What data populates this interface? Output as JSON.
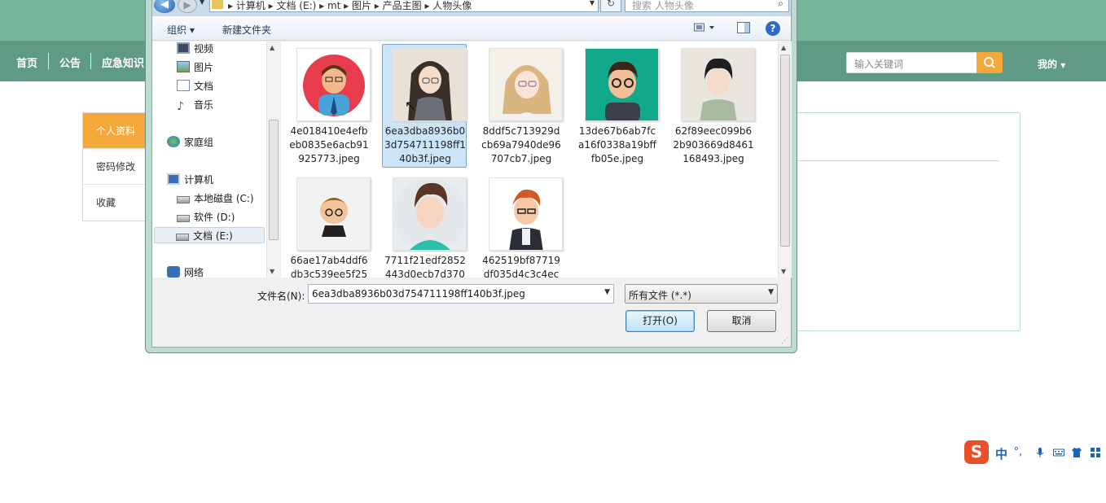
{
  "site": {
    "nav": [
      "首页",
      "公告",
      "应急知识"
    ],
    "search_placeholder": "输入关键词",
    "user_menu": "我的",
    "side_menu": [
      "个人资料",
      "密码修改",
      "收藏"
    ],
    "colors": {
      "topband": "#77b59b",
      "navbar": "#5e9a84",
      "accent": "#f5a83a"
    }
  },
  "dialog": {
    "address": "▸ 计算机 ▸ 文档 (E:) ▸ mt ▸ 图片 ▸ 产品主图 ▸ 人物头像",
    "search_placeholder": "搜索 人物头像",
    "toolbar": {
      "organize": "组织 ▾",
      "new_folder": "新建文件夹"
    },
    "nav_items": [
      {
        "label": "视频",
        "icon": "video-icon"
      },
      {
        "label": "图片",
        "icon": "pictures-icon"
      },
      {
        "label": "文档",
        "icon": "documents-icon"
      },
      {
        "label": "音乐",
        "icon": "music-icon"
      },
      {
        "label": "家庭组",
        "icon": "homegroup-icon"
      },
      {
        "label": "计算机",
        "icon": "computer-icon"
      },
      {
        "label": "本地磁盘 (C:)",
        "icon": "drive-icon"
      },
      {
        "label": "软件 (D:)",
        "icon": "drive-icon"
      },
      {
        "label": "文档 (E:)",
        "icon": "drive-icon"
      },
      {
        "label": "网络",
        "icon": "network-icon"
      }
    ],
    "files": [
      {
        "name": "4e018410e4efbeb0835e6acb91925773.jpeg",
        "bg": "#e83c4c"
      },
      {
        "name": "6ea3dba8936b03d754711198ff140b3f.jpeg",
        "bg": "#e8e1d8"
      },
      {
        "name": "8ddf5c713929dcb69a7940de96707cb7.jpeg",
        "bg": "#f4efe8"
      },
      {
        "name": "13de67b6ab7fca16f0338a19bfffb05e.jpeg",
        "bg": "#12a88c"
      },
      {
        "name": "62f89eec099b62b903669d8461168493.jpeg",
        "bg": "#e9e6df"
      },
      {
        "name": "66ae17ab4ddf6db3c539ee5f25",
        "bg": "#f2f2f2"
      },
      {
        "name": "7711f21edf2852443d0ecb7d370",
        "bg": "#e9ecef"
      },
      {
        "name": "462519bf87719df035d4c3c4ec",
        "bg": "#ffffff"
      }
    ],
    "filename_label": "文件名(N):",
    "filename_value": "6ea3dba8936b03d754711198ff140b3f.jpeg",
    "filetype": "所有文件 (*.*)",
    "open_button": "打开(O)",
    "cancel_button": "取消"
  },
  "ime": {
    "logo": "S",
    "mode": "中"
  }
}
